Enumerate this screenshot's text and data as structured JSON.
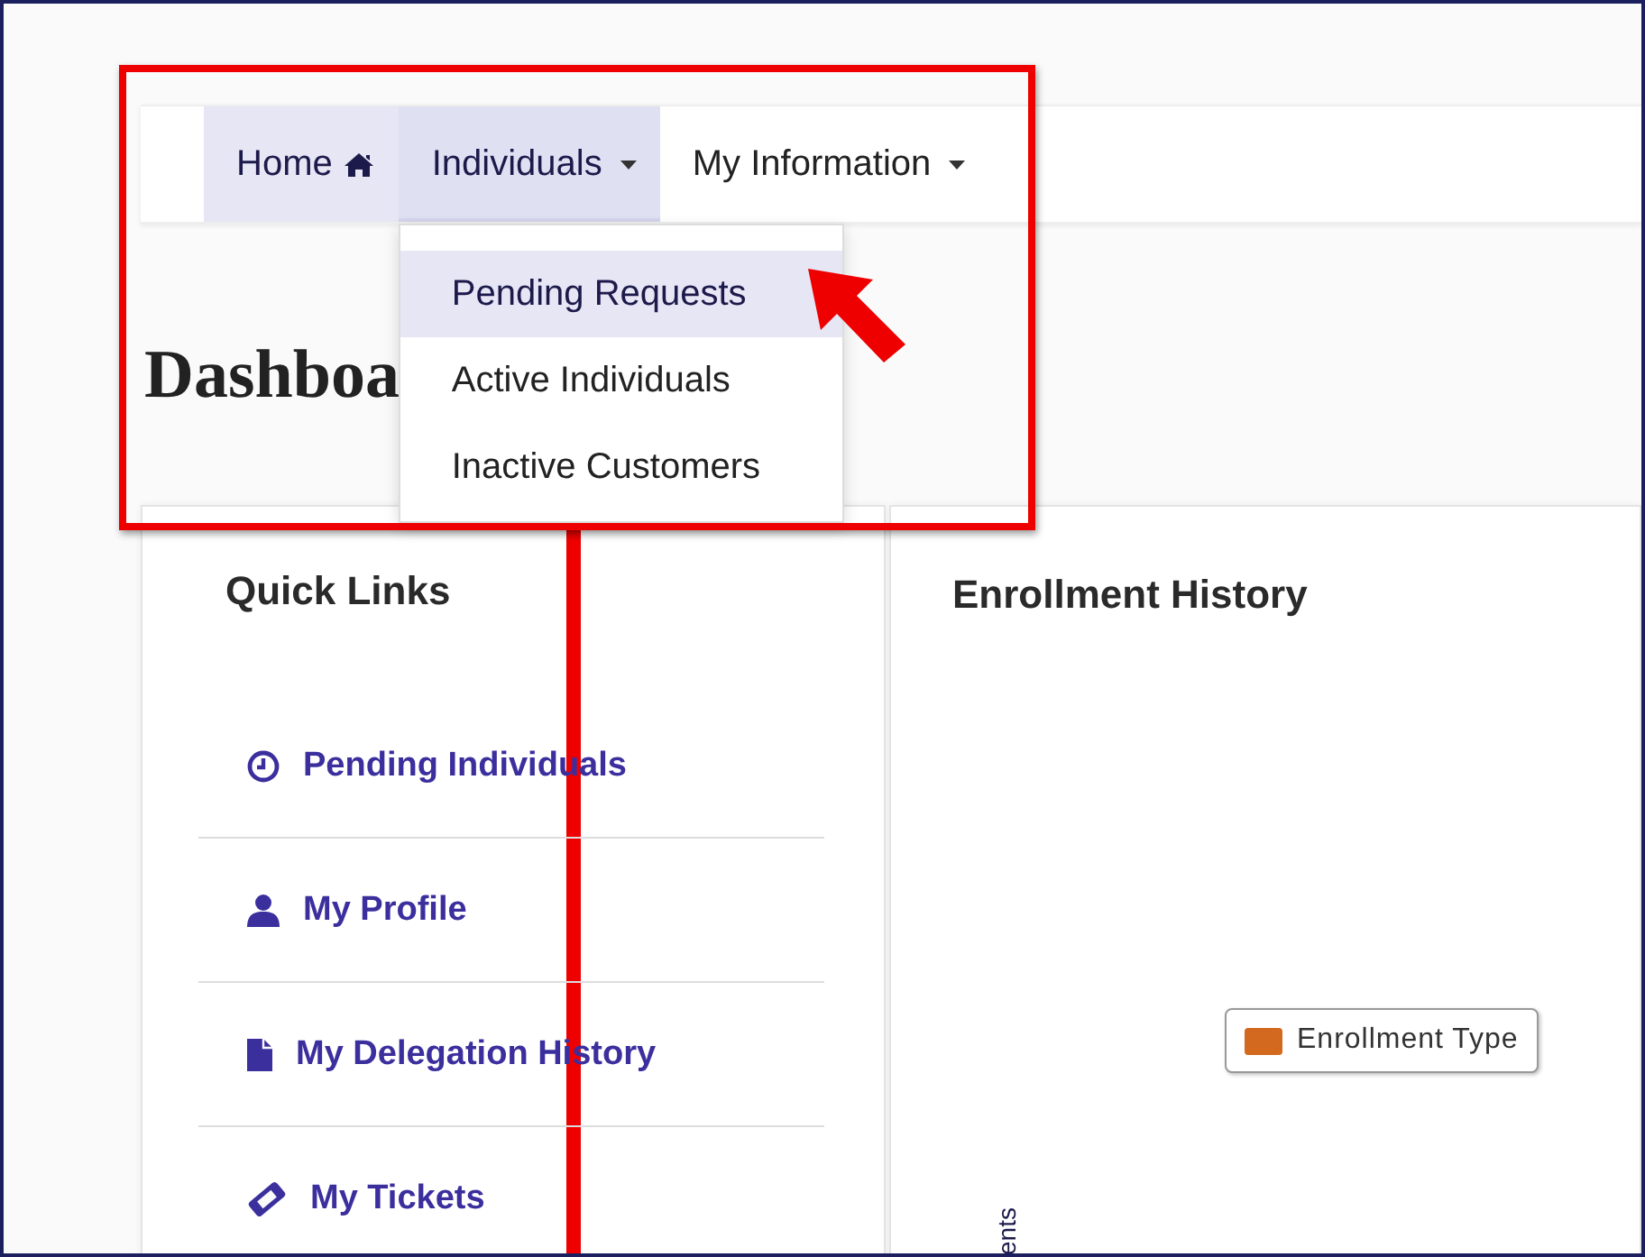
{
  "nav": {
    "items": [
      {
        "label": "Home",
        "kind": "home",
        "highlighted": true,
        "expanded": false
      },
      {
        "label": "Individuals",
        "kind": "dropdown",
        "highlighted": true,
        "expanded": true,
        "menu": [
          {
            "label": "Pending Requests",
            "selected": true
          },
          {
            "label": "Active Individuals",
            "selected": false
          },
          {
            "label": "Inactive Customers",
            "selected": false
          }
        ]
      },
      {
        "label": "My Information",
        "kind": "dropdown",
        "highlighted": false,
        "expanded": false
      }
    ]
  },
  "page_title": "Dashboa",
  "quick_links": {
    "title": "Quick Links",
    "items": [
      {
        "label": "Pending Individuals",
        "kind": "clock"
      },
      {
        "label": "My Profile",
        "kind": "person"
      },
      {
        "label": "My Delegation History",
        "kind": "document"
      },
      {
        "label": "My Tickets",
        "kind": "ticket"
      }
    ]
  },
  "enrollment": {
    "title": "Enrollment History",
    "legend": [
      {
        "label": "Enrollment Type",
        "color": "#d2691e"
      }
    ],
    "axis_label": "ents"
  }
}
